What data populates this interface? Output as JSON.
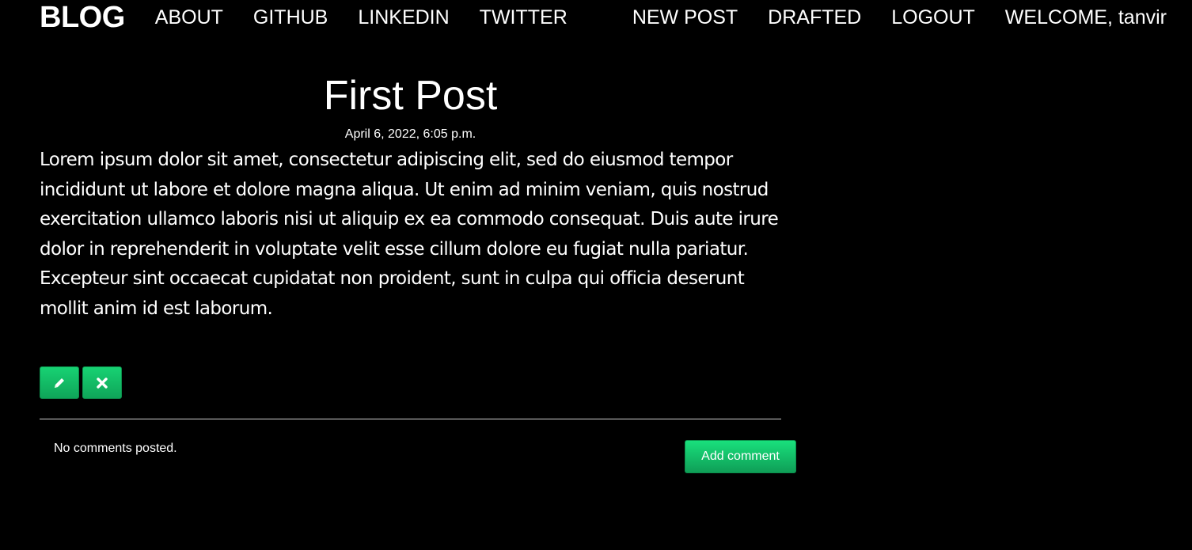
{
  "nav": {
    "brand": "BLOG",
    "left_links": [
      {
        "label": "ABOUT"
      },
      {
        "label": "GITHUB"
      },
      {
        "label": "LINKEDIN"
      },
      {
        "label": "TWITTER"
      }
    ],
    "right_links": [
      {
        "label": "NEW POST"
      },
      {
        "label": "DRAFTED"
      },
      {
        "label": "LOGOUT"
      }
    ],
    "welcome": "WELCOME, tanvir"
  },
  "post": {
    "title": "First Post",
    "date": "April 6, 2022, 6:05 p.m.",
    "body": "Lorem ipsum dolor sit amet, consectetur adipiscing elit, sed do eiusmod tempor incididunt ut labore et dolore magna aliqua. Ut enim ad minim veniam, quis nostrud exercitation ullamco laboris nisi ut aliquip ex ea commodo consequat. Duis aute irure dolor in reprehenderit in voluptate velit esse cillum dolore eu fugiat nulla pariatur. Excepteur sint occaecat cupidatat non proident, sunt in culpa qui officia deserunt mollit anim id est laborum.",
    "edit_icon": "pencil-icon",
    "delete_icon": "close-icon"
  },
  "comments": {
    "empty_text": "No comments posted.",
    "add_label": "Add comment"
  },
  "colors": {
    "background": "#000000",
    "text": "#ffffff",
    "accent": "#17d273"
  }
}
